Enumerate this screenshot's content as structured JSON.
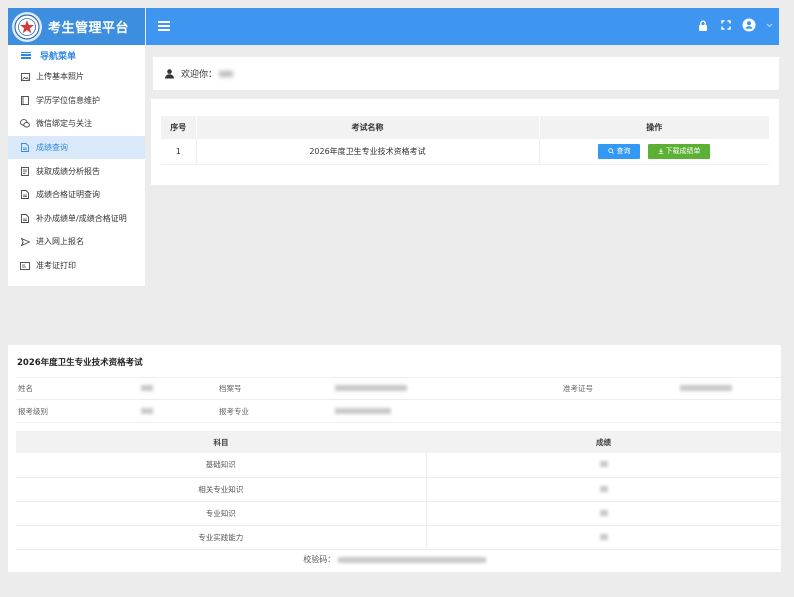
{
  "app": {
    "title": "考生管理平台"
  },
  "topbar": {
    "icons": [
      "lock-icon",
      "fullscreen-icon",
      "user-avatar-icon",
      "chevron-down-icon"
    ]
  },
  "sidebar": {
    "header": "导航菜单",
    "items": [
      {
        "label": "上传基本照片",
        "icon": "image-icon"
      },
      {
        "label": "学历学位信息维护",
        "icon": "book-icon"
      },
      {
        "label": "微信绑定与关注",
        "icon": "wechat-icon"
      },
      {
        "label": "成绩查询",
        "icon": "document-icon",
        "active": true
      },
      {
        "label": "获取成绩分析报告",
        "icon": "report-icon"
      },
      {
        "label": "成绩合格证明查询",
        "icon": "certificate-icon"
      },
      {
        "label": "补办成绩单/成绩合格证明",
        "icon": "file-icon"
      },
      {
        "label": "进入网上报名",
        "icon": "send-icon"
      },
      {
        "label": "准考证打印",
        "icon": "card-icon"
      }
    ]
  },
  "welcome": {
    "text": "欢迎你："
  },
  "exam_list": {
    "headers": [
      "序号",
      "考试名称",
      "操作"
    ],
    "rows": [
      {
        "index": "1",
        "name": "2026年度卫生专业技术资格考试",
        "query_label": "查询",
        "download_label": "下载成绩单"
      }
    ]
  },
  "score": {
    "title": "2026年度卫生专业技术资格考试",
    "labels": {
      "name": "姓名",
      "archive_no": "档案号",
      "admission_no": "准考证号",
      "category": "报考级别",
      "major": "报考专业"
    },
    "table_headers": [
      "科目",
      "成绩"
    ],
    "subjects": [
      "基础知识",
      "相关专业知识",
      "专业知识",
      "专业实践能力"
    ],
    "verify_label": "校验码："
  },
  "colors": {
    "brand": "#3d8ede",
    "topbar": "#3f96f0",
    "query_btn": "#3399f3",
    "download_btn": "#5cb034",
    "active_nav_bg": "#d9e9f9"
  }
}
